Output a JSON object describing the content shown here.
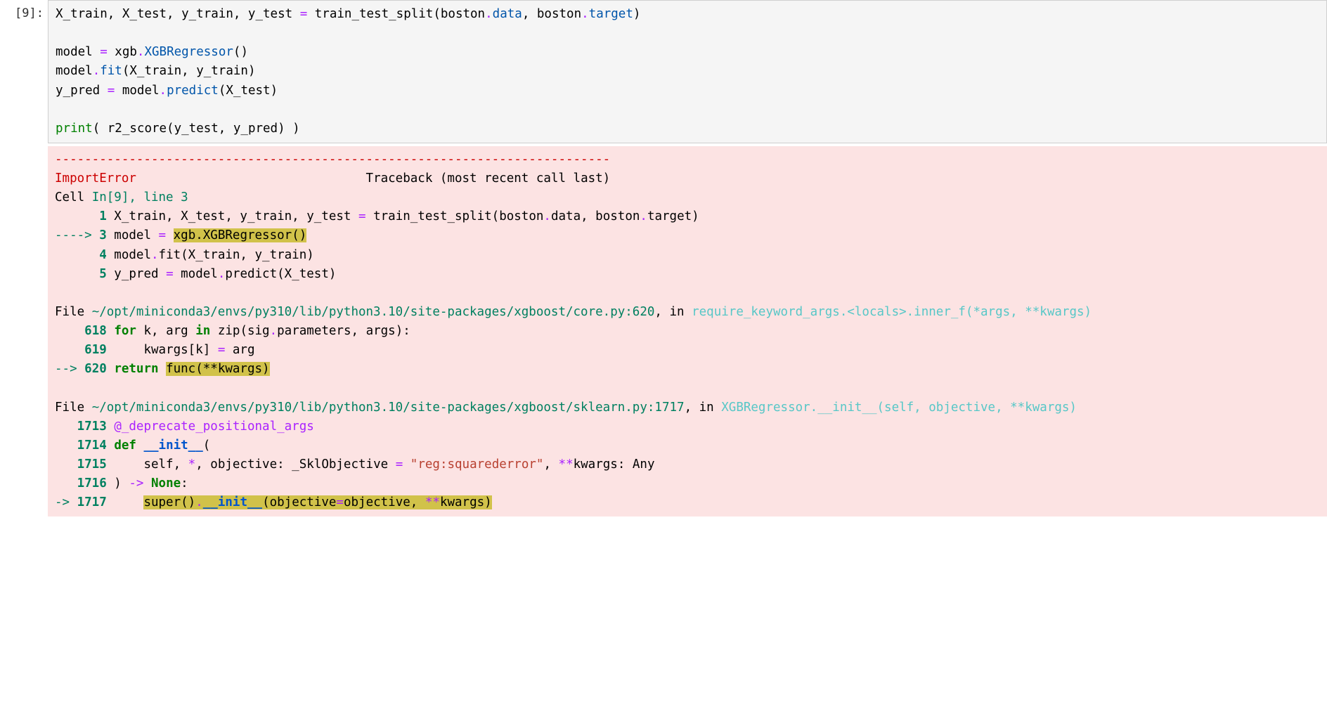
{
  "cell": {
    "prompt_open": "[",
    "prompt_num": "9",
    "prompt_close": "]:",
    "code": {
      "l1": {
        "a": "X_train, X_test, y_train, y_test ",
        "eq": "=",
        "b": " train_test_split(boston",
        "dot1": ".",
        "attr1": "data",
        "c": ", boston",
        "dot2": ".",
        "attr2": "target",
        "d": ")"
      },
      "l3": {
        "a": "model ",
        "eq": "=",
        "b": " xgb",
        "dot": ".",
        "cls": "XGBRegressor",
        "c": "()"
      },
      "l4": {
        "a": "model",
        "dot": ".",
        "m": "fit",
        "b": "(X_train, y_train)"
      },
      "l5": {
        "a": "y_pred ",
        "eq": "=",
        "b": " model",
        "dot": ".",
        "m": "predict",
        "c": "(X_test)"
      },
      "l7": {
        "p": "print",
        "a": "( r2_score(y_test, y_pred) )"
      }
    }
  },
  "tb": {
    "dashes": "---------------------------------------------------------------------------",
    "header": {
      "exc": "ImportError",
      "spaces": "                               ",
      "label": "Traceback (most recent call last)"
    },
    "loc1": {
      "pre": "Cell ",
      "where": "In[9], line 3"
    },
    "fr1": {
      "l1": {
        "no": "1",
        "txt": " X_train, X_test, y_train, y_test ",
        "eq": "=",
        "rest": " train_test_split(boston",
        "d1": ".",
        "a1": "data, boston",
        "d2": ".",
        "a2": "target)"
      },
      "l3": {
        "arrow": "----> ",
        "no": "3",
        "txt": " model ",
        "eq": "=",
        "sp": " ",
        "hl": "xgb.XGBRegressor()"
      },
      "l4": {
        "no": "4",
        "txt": " model",
        "d": ".",
        "rest": "fit(X_train, y_train)"
      },
      "l5": {
        "no": "5",
        "txt": " y_pred ",
        "eq": "=",
        "rest": " model",
        "d": ".",
        "rest2": "predict(X_test)"
      }
    },
    "file1": {
      "pre": "File ",
      "path": "~/opt/miniconda3/envs/py310/lib/python3.10/site-packages/xgboost/core.py:620",
      "in": ", in ",
      "sig": "require_keyword_args.<locals>.inner_f(*args, **kwargs)"
    },
    "fr2": {
      "l618": {
        "no": "618",
        "sp": " ",
        "kw": "for",
        "a": " k, arg ",
        "kw2": "in",
        "b": " zip(sig",
        "d": ".",
        "c": "parameters, args):"
      },
      "l619": {
        "no": "619",
        "txt": "     kwargs[k] ",
        "eq": "=",
        "rest": " arg"
      },
      "l620": {
        "arrow": "--> ",
        "no": "620",
        "sp": " ",
        "kw": "return",
        "sp2": " ",
        "hl": "func(**kwargs)"
      }
    },
    "file2": {
      "pre": "File ",
      "path": "~/opt/miniconda3/envs/py310/lib/python3.10/site-packages/xgboost/sklearn.py:1717",
      "in": ", in ",
      "sig": "XGBRegressor.__init__(self, objective, **kwargs)"
    },
    "fr3": {
      "l1713": {
        "no": "1713",
        "sp": " ",
        "dec": "@_deprecate_positional_args"
      },
      "l1714": {
        "no": "1714",
        "sp": " ",
        "def": "def",
        "sp2": " ",
        "fname": "__init__",
        "rest": "("
      },
      "l1715": {
        "no": "1715",
        "txt": "     self, ",
        "star": "*",
        "a": ", objective: _SklObjective ",
        "eq": "=",
        "sp": " ",
        "str": "\"reg:squarederror\"",
        "b": ", ",
        "dstar": "**",
        "c": "kwargs: Any"
      },
      "l1716": {
        "no": "1716",
        "a": " ) ",
        "arrow": "->",
        "sp": " ",
        "none": "None",
        "colon": ":"
      },
      "l1717": {
        "arrow": "-> ",
        "no": "1717",
        "sp": "     ",
        "hl_a": "super()",
        "d": ".",
        "init": "__init__",
        "hl_b": "(objective",
        "eq": "=",
        "hl_c": "objective, ",
        "dstar": "**",
        "hl_d": "kwargs)"
      }
    }
  }
}
